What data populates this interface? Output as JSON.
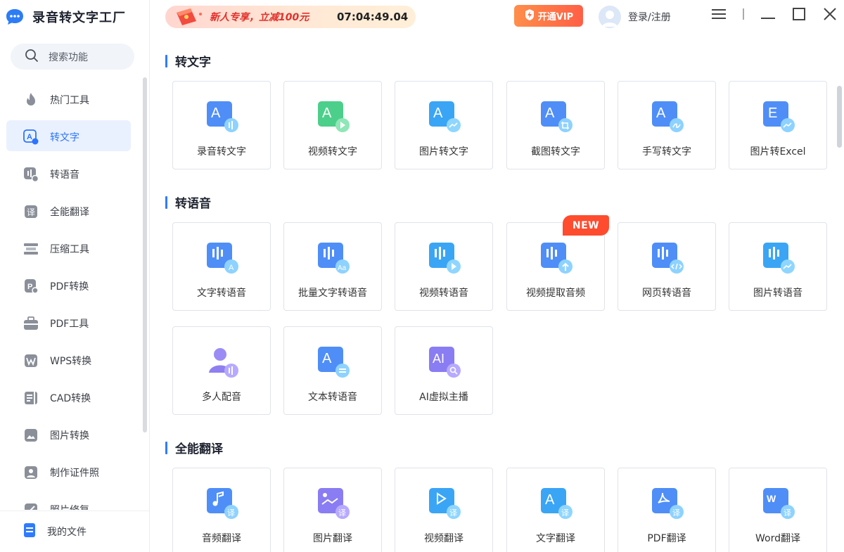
{
  "app": {
    "title": "录音转文字工厂"
  },
  "search": {
    "label": "搜索功能"
  },
  "sidebar": {
    "items": [
      {
        "label": "热门工具",
        "icon": "flame-icon"
      },
      {
        "label": "转文字",
        "icon": "text-convert-icon"
      },
      {
        "label": "转语音",
        "icon": "voice-icon"
      },
      {
        "label": "全能翻译",
        "icon": "translate-icon"
      },
      {
        "label": "压缩工具",
        "icon": "compress-icon"
      },
      {
        "label": "PDF转换",
        "icon": "pdf-convert-icon"
      },
      {
        "label": "PDF工具",
        "icon": "toolbox-icon"
      },
      {
        "label": "WPS转换",
        "icon": "wps-icon"
      },
      {
        "label": "CAD转换",
        "icon": "cad-icon"
      },
      {
        "label": "图片转换",
        "icon": "image-convert-icon"
      },
      {
        "label": "制作证件照",
        "icon": "id-photo-icon"
      },
      {
        "label": "照片修复",
        "icon": "photo-repair-icon"
      }
    ],
    "active_index": 1,
    "bottom": {
      "label": "我的文件",
      "icon": "file-icon"
    }
  },
  "topbar": {
    "promo_text": "新人专享，立减100元",
    "promo_timer": "07:04:49.04",
    "vip_label": "开通VIP",
    "login_label": "登录/注册"
  },
  "sections": [
    {
      "title": "转文字",
      "cards": [
        "录音转文字",
        "视频转文字",
        "图片转文字",
        "截图转文字",
        "手写转文字",
        "图片转Excel"
      ]
    },
    {
      "title": "转语音",
      "cards": [
        "文字转语音",
        "批量文字转语音",
        "视频转语音",
        "视频提取音频",
        "网页转语音",
        "图片转语音",
        "多人配音",
        "文本转语音",
        "AI虚拟主播"
      ]
    },
    {
      "title": "全能翻译",
      "cards": [
        "音频翻译",
        "图片翻译",
        "视频翻译",
        "文字翻译",
        "PDF翻译",
        "Word翻译"
      ]
    }
  ],
  "badges": {
    "new": "NEW"
  },
  "colors": {
    "accent": "#2a74ff",
    "promo_red": "#e2312c",
    "vip": "#ff6a45",
    "new_badge": "#ff4b2e"
  }
}
